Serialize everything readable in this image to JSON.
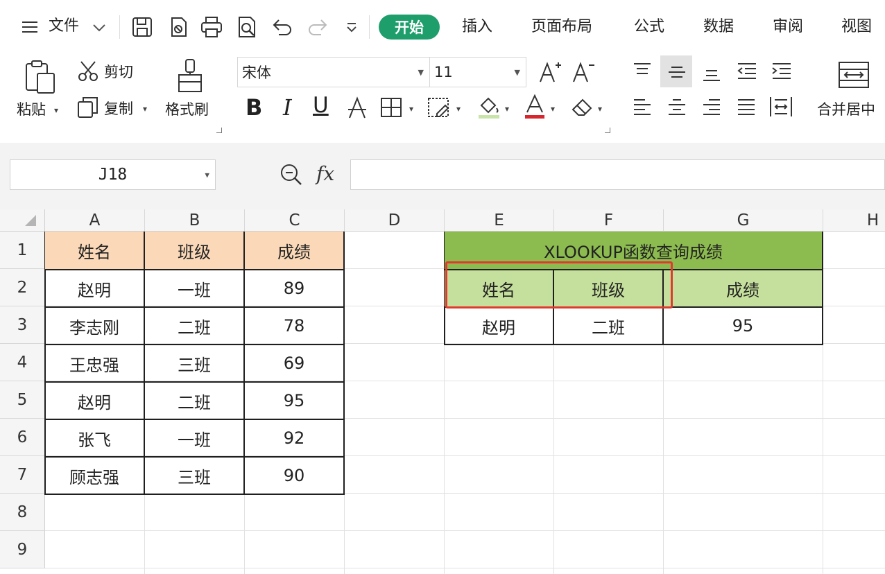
{
  "menu": {
    "file_label": "文件",
    "tabs": [
      "开始",
      "插入",
      "页面布局",
      "公式",
      "数据",
      "审阅",
      "视图"
    ]
  },
  "ribbon": {
    "paste": "粘贴",
    "cut": "剪切",
    "copy": "复制",
    "format_painter": "格式刷",
    "font_name": "宋体",
    "font_size": "11",
    "bold": "B",
    "italic": "I",
    "underline": "U",
    "merge_center": "合并居中"
  },
  "formula_bar": {
    "cell_ref": "J18",
    "fx": "fx",
    "formula": ""
  },
  "sheet": {
    "columns": [
      "A",
      "B",
      "C",
      "D",
      "E",
      "F",
      "G",
      "H"
    ],
    "rows": [
      "1",
      "2",
      "3",
      "4",
      "5",
      "6",
      "7",
      "8",
      "9"
    ],
    "source_table": {
      "headers": [
        "姓名",
        "班级",
        "成绩"
      ],
      "rows": [
        [
          "赵明",
          "一班",
          "89"
        ],
        [
          "李志刚",
          "二班",
          "78"
        ],
        [
          "王忠强",
          "三班",
          "69"
        ],
        [
          "赵明",
          "二班",
          "95"
        ],
        [
          "张飞",
          "一班",
          "92"
        ],
        [
          "顾志强",
          "三班",
          "90"
        ]
      ]
    },
    "lookup_table": {
      "title": "XLOOKUP函数查询成绩",
      "headers": [
        "姓名",
        "班级",
        "成绩"
      ],
      "row": [
        "赵明",
        "二班",
        "95"
      ]
    }
  },
  "colors": {
    "accent": "#1e9e6b",
    "header_orange": "#fbd9b8",
    "title_green": "#8cbb4f",
    "header_green": "#c5df9c",
    "highlight_red": "#e03a2f"
  }
}
